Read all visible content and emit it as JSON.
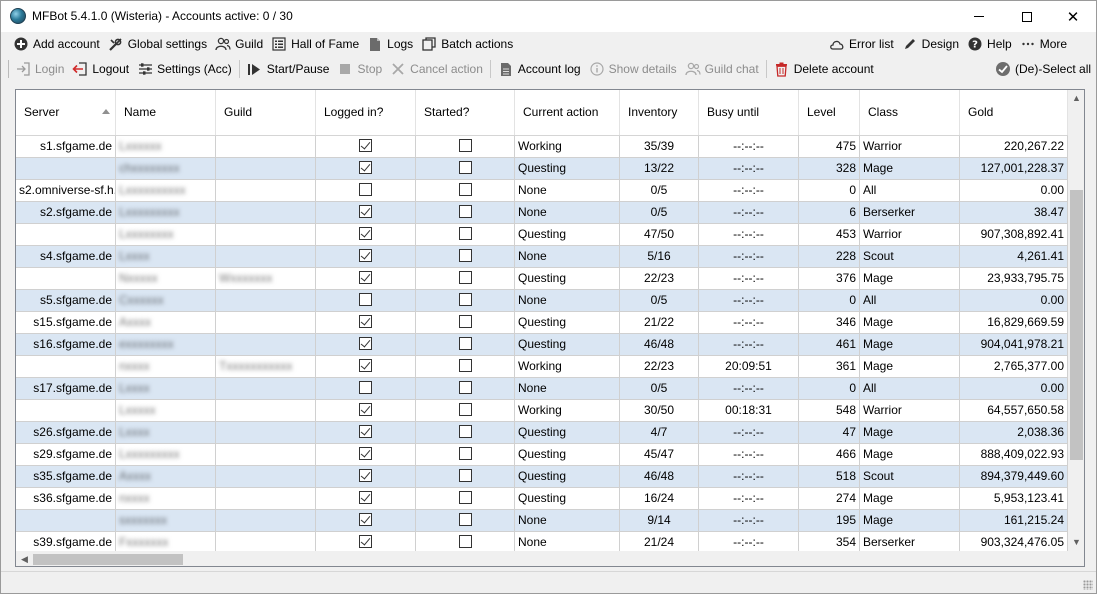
{
  "window": {
    "title": "MFBot 5.4.1.0 (Wisteria) - Accounts active: 0 / 30",
    "controls": {
      "minimize": "—",
      "maximize": "☐",
      "close": "✕"
    }
  },
  "toolbar1": {
    "left": [
      {
        "label": "Add account",
        "icon": "plus-circle-icon"
      },
      {
        "label": "Global settings",
        "icon": "wrench-icon"
      },
      {
        "label": "Guild",
        "icon": "users-icon"
      },
      {
        "label": "Hall of Fame",
        "icon": "list-icon"
      },
      {
        "label": "Logs",
        "icon": "document-icon"
      },
      {
        "label": "Batch actions",
        "icon": "copy-icon"
      }
    ],
    "right": [
      {
        "label": "Error list",
        "icon": "cloud-icon"
      },
      {
        "label": "Design",
        "icon": "pencil-icon"
      },
      {
        "label": "Help",
        "icon": "question-icon"
      },
      {
        "label": "More",
        "icon": "dots-icon"
      }
    ]
  },
  "toolbar2": {
    "items": [
      {
        "label": "Login",
        "icon": "login-icon",
        "enabled": false
      },
      {
        "label": "Logout",
        "icon": "logout-icon",
        "enabled": true
      },
      {
        "label": "Settings (Acc)",
        "icon": "sliders-icon",
        "enabled": true
      },
      {
        "label": "Start/Pause",
        "icon": "play-pause-icon",
        "enabled": true
      },
      {
        "label": "Stop",
        "icon": "stop-icon",
        "enabled": false
      },
      {
        "label": "Cancel action",
        "icon": "x-icon",
        "enabled": false
      },
      {
        "label": "Account log",
        "icon": "document-icon",
        "enabled": true
      },
      {
        "label": "Show details",
        "icon": "info-icon",
        "enabled": false
      },
      {
        "label": "Guild chat",
        "icon": "users-icon",
        "enabled": false
      },
      {
        "label": "Delete account",
        "icon": "trash-icon",
        "enabled": true
      }
    ],
    "right": {
      "label": "(De)-Select all",
      "icon": "check-circle-icon"
    }
  },
  "grid": {
    "columns": [
      "Server",
      "Name",
      "Guild",
      "Logged in?",
      "Started?",
      "Current action",
      "Inventory",
      "Busy until",
      "Level",
      "Class",
      "Gold"
    ],
    "rows": [
      {
        "server": "s1.sfgame.de",
        "name": "Lxxxxxx",
        "guild": "",
        "logged_in": true,
        "started": false,
        "action": "Working",
        "inventory": "35/39",
        "busy": "--:--:--",
        "level": "475",
        "class": "Warrior",
        "gold": "220,267.22"
      },
      {
        "server": "",
        "name": "chxxxxxxxx",
        "guild": "",
        "logged_in": true,
        "started": false,
        "action": "Questing",
        "inventory": "13/22",
        "busy": "--:--:--",
        "level": "328",
        "class": "Mage",
        "gold": "127,001,228.37"
      },
      {
        "server": "s2.omniverse-sf.h...",
        "name": "Lxxxxxxxxxx",
        "guild": "",
        "logged_in": false,
        "started": false,
        "action": "None",
        "inventory": "0/5",
        "busy": "--:--:--",
        "level": "0",
        "class": "All",
        "gold": "0.00"
      },
      {
        "server": "s2.sfgame.de",
        "name": "Lxxxxxxxxx",
        "guild": "",
        "logged_in": true,
        "started": false,
        "action": "None",
        "inventory": "0/5",
        "busy": "--:--:--",
        "level": "6",
        "class": "Berserker",
        "gold": "38.47"
      },
      {
        "server": "",
        "name": "Lxxxxxxxx",
        "guild": "",
        "logged_in": true,
        "started": false,
        "action": "Questing",
        "inventory": "47/50",
        "busy": "--:--:--",
        "level": "453",
        "class": "Warrior",
        "gold": "907,308,892.41"
      },
      {
        "server": "s4.sfgame.de",
        "name": "Lxxxx",
        "guild": "",
        "logged_in": true,
        "started": false,
        "action": "None",
        "inventory": "5/16",
        "busy": "--:--:--",
        "level": "228",
        "class": "Scout",
        "gold": "4,261.41"
      },
      {
        "server": "",
        "name": "Nxxxxx",
        "guild": "Wxxxxxxx",
        "logged_in": true,
        "started": false,
        "action": "Questing",
        "inventory": "22/23",
        "busy": "--:--:--",
        "level": "376",
        "class": "Mage",
        "gold": "23,933,795.75"
      },
      {
        "server": "s5.sfgame.de",
        "name": "Cxxxxxx",
        "guild": "",
        "logged_in": false,
        "started": false,
        "action": "None",
        "inventory": "0/5",
        "busy": "--:--:--",
        "level": "0",
        "class": "All",
        "gold": "0.00"
      },
      {
        "server": "s15.sfgame.de",
        "name": "Axxxx",
        "guild": "",
        "logged_in": true,
        "started": false,
        "action": "Questing",
        "inventory": "21/22",
        "busy": "--:--:--",
        "level": "346",
        "class": "Mage",
        "gold": "16,829,669.59"
      },
      {
        "server": "s16.sfgame.de",
        "name": "exxxxxxxx",
        "guild": "",
        "logged_in": true,
        "started": false,
        "action": "Questing",
        "inventory": "46/48",
        "busy": "--:--:--",
        "level": "461",
        "class": "Mage",
        "gold": "904,041,978.21"
      },
      {
        "server": "",
        "name": "nxxxx",
        "guild": "Txxxxxxxxxxx",
        "logged_in": true,
        "started": false,
        "action": "Working",
        "inventory": "22/23",
        "busy": "20:09:51",
        "level": "361",
        "class": "Mage",
        "gold": "2,765,377.00"
      },
      {
        "server": "s17.sfgame.de",
        "name": "Lxxxx",
        "guild": "",
        "logged_in": false,
        "started": false,
        "action": "None",
        "inventory": "0/5",
        "busy": "--:--:--",
        "level": "0",
        "class": "All",
        "gold": "0.00"
      },
      {
        "server": "",
        "name": "Lxxxxx",
        "guild": "",
        "logged_in": true,
        "started": false,
        "action": "Working",
        "inventory": "30/50",
        "busy": "00:18:31",
        "level": "548",
        "class": "Warrior",
        "gold": "64,557,650.58"
      },
      {
        "server": "s26.sfgame.de",
        "name": "Lxxxx",
        "guild": "",
        "logged_in": true,
        "started": false,
        "action": "Questing",
        "inventory": "4/7",
        "busy": "--:--:--",
        "level": "47",
        "class": "Mage",
        "gold": "2,038.36"
      },
      {
        "server": "s29.sfgame.de",
        "name": "Lxxxxxxxxx",
        "guild": "",
        "logged_in": true,
        "started": false,
        "action": "Questing",
        "inventory": "45/47",
        "busy": "--:--:--",
        "level": "466",
        "class": "Mage",
        "gold": "888,409,022.93"
      },
      {
        "server": "s35.sfgame.de",
        "name": "Axxxx",
        "guild": "",
        "logged_in": true,
        "started": false,
        "action": "Questing",
        "inventory": "46/48",
        "busy": "--:--:--",
        "level": "518",
        "class": "Scout",
        "gold": "894,379,449.60"
      },
      {
        "server": "s36.sfgame.de",
        "name": "nxxxx",
        "guild": "",
        "logged_in": true,
        "started": false,
        "action": "Questing",
        "inventory": "16/24",
        "busy": "--:--:--",
        "level": "274",
        "class": "Mage",
        "gold": "5,953,123.41"
      },
      {
        "server": "",
        "name": "sxxxxxxx",
        "guild": "",
        "logged_in": true,
        "started": false,
        "action": "None",
        "inventory": "9/14",
        "busy": "--:--:--",
        "level": "195",
        "class": "Mage",
        "gold": "161,215.24"
      },
      {
        "server": "s39.sfgame.de",
        "name": "Fxxxxxxx",
        "guild": "",
        "logged_in": true,
        "started": false,
        "action": "None",
        "inventory": "21/24",
        "busy": "--:--:--",
        "level": "354",
        "class": "Berserker",
        "gold": "903,324,476.05"
      }
    ]
  },
  "scroll": {
    "up": "▲",
    "down": "▼",
    "left": "◀"
  }
}
